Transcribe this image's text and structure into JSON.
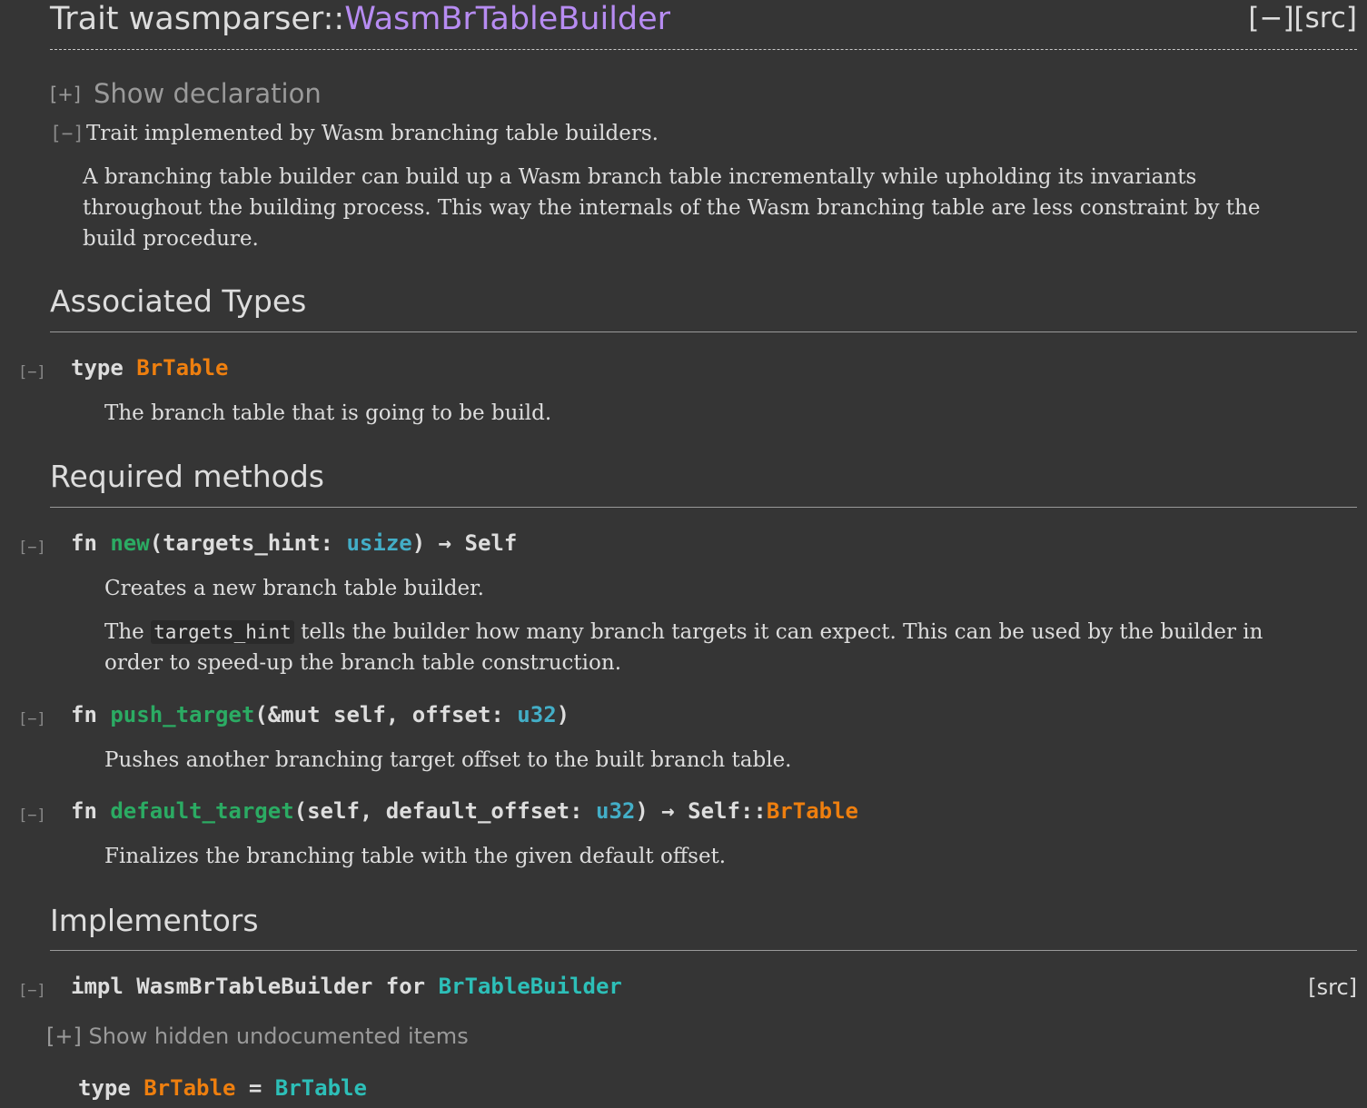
{
  "title": {
    "prefix": "Trait wasmparser::",
    "name": "WasmBrTableBuilder",
    "collapse_link": "[−]",
    "src_link": "[src]"
  },
  "declaration": {
    "toggle": "[+]",
    "label": "Show declaration"
  },
  "docs": {
    "toggle": "[−]",
    "summary": "Trait implemented by Wasm branching table builders.",
    "body_line1": "A branching table builder can build up a Wasm branch table incrementally while upholding its invariants",
    "body_line2": "throughout the building process. This way the internals of the Wasm branching table are less constraint by the",
    "body_line3": "build procedure."
  },
  "associated_types": {
    "heading": "Associated Types",
    "items": [
      {
        "toggle": "[−]",
        "keyword": "type",
        "name": "BrTable",
        "doc": "The branch table that is going to be build."
      }
    ]
  },
  "required_methods": {
    "heading": "Required methods",
    "items": [
      {
        "toggle": "[−]",
        "keyword": "fn",
        "name": "new",
        "args_open": "(targets_hint: ",
        "arg_type": "usize",
        "args_close": ") → Self",
        "doc1": "Creates a new branch table builder.",
        "doc2_pre": "The",
        "doc2_code": "targets_hint",
        "doc2_post": "tells the builder how many branch targets it can expect. This can be used by the builder in",
        "doc2_line2": "order to speed-up the branch table construction."
      },
      {
        "toggle": "[−]",
        "keyword": "fn",
        "name": "push_target",
        "args_open": "(&mut self, offset: ",
        "arg_type": "u32",
        "args_close": ")",
        "doc1": "Pushes another branching target offset to the built branch table."
      },
      {
        "toggle": "[−]",
        "keyword": "fn",
        "name": "default_target",
        "args_open": "(self, default_offset: ",
        "arg_type": "u32",
        "args_mid": ") → Self::",
        "ret_type": "BrTable",
        "doc1": "Finalizes the branching table with the given default offset."
      }
    ]
  },
  "implementors": {
    "heading": "Implementors",
    "impl": {
      "toggle": "[−]",
      "prefix": "impl WasmBrTableBuilder for ",
      "struct": "BrTableBuilder",
      "src_link": "[src]"
    },
    "hidden_toggle": "[+]",
    "hidden_label": "Show hidden undocumented items",
    "type_line": {
      "keyword": "type",
      "name": "BrTable",
      "eq": " = ",
      "value": "BrTable"
    }
  }
}
